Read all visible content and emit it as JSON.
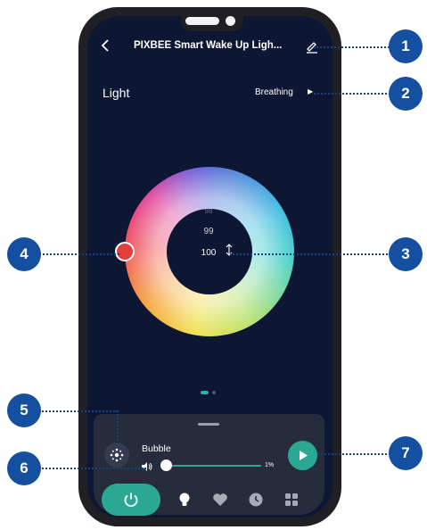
{
  "header": {
    "title": "PIXBEE Smart Wake Up Ligh...",
    "back_icon": "chevron-left-icon",
    "edit_icon": "pencil-icon"
  },
  "light_section": {
    "label": "Light",
    "mode": "Breathing",
    "mode_icon": "play-arrow-icon"
  },
  "color_wheel": {
    "selected_color": "#e53c3c",
    "brightness_values": [
      "98",
      "99",
      "100"
    ]
  },
  "page_indicator": {
    "pages": 2,
    "active": 1
  },
  "effect_panel": {
    "effect_icon": "sparkle-icon",
    "effect_name": "Bubble",
    "volume_icon": "speaker-icon",
    "volume_percent": "1%",
    "volume_value": 0.01,
    "play_icon": "play-icon"
  },
  "bottom_nav": {
    "items": [
      "power-icon",
      "bulb-icon",
      "heart-icon",
      "clock-icon",
      "grid-icon"
    ]
  },
  "callouts": [
    "1",
    "2",
    "3",
    "4",
    "5",
    "6",
    "7"
  ],
  "colors": {
    "accent": "#2aa892",
    "screen_bg": "#0d1733",
    "panel_bg": "#262c3c",
    "badge": "#154fa0"
  }
}
